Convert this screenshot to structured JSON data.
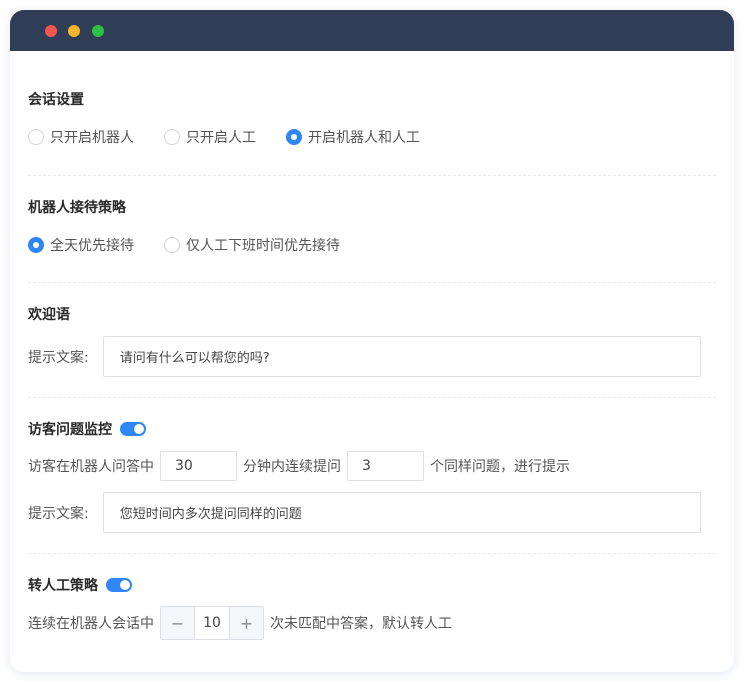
{
  "colors": {
    "titlebar": "#2f3e56",
    "accent": "#2f86f6",
    "close": "#f2574f",
    "minimize": "#f7b52c",
    "maximize": "#2dc246"
  },
  "session": {
    "title": "会话设置",
    "options": [
      "只开启机器人",
      "只开启人工",
      "开启机器人和人工"
    ],
    "selected": "开启机器人和人工"
  },
  "robot_strategy": {
    "title": "机器人接待策略",
    "options": [
      "全天优先接待",
      "仅人工下班时间优先接待"
    ],
    "selected": "全天优先接待"
  },
  "welcome": {
    "title": "欢迎语",
    "label": "提示文案:",
    "value": "请问有什么可以帮您的吗?"
  },
  "monitor": {
    "title": "访客问题监控",
    "enabled": true,
    "text1": "访客在机器人问答中",
    "minutes": "30",
    "text2": "分钟内连续提问",
    "count": "3",
    "text3": "个同样问题，进行提示",
    "label": "提示文案:",
    "value": "您短时间内多次提问同样的问题"
  },
  "transfer": {
    "title": "转人工策略",
    "enabled": true,
    "text1": "连续在机器人会话中",
    "minus": "−",
    "value": "10",
    "plus": "+",
    "text2": "次未匹配中答案，默认转人工"
  }
}
